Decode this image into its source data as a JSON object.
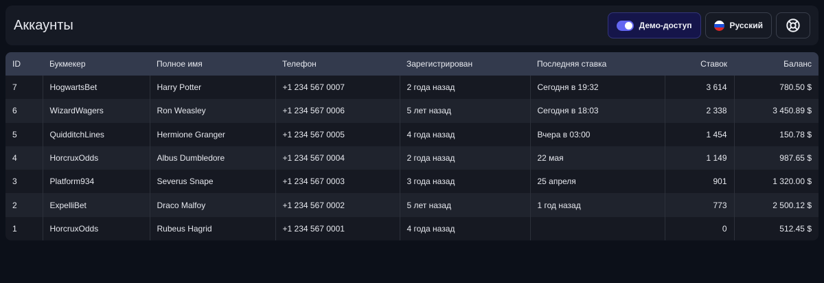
{
  "header": {
    "title": "Аккаунты",
    "demo_label": "Демо-доступ",
    "demo_enabled": true,
    "language_label": "Русский",
    "help_icon": "lifebuoy-icon"
  },
  "table": {
    "columns": [
      "ID",
      "Букмекер",
      "Полное имя",
      "Телефон",
      "Зарегистрирован",
      "Последняя ставка",
      "Ставок",
      "Баланс"
    ],
    "rows": [
      [
        "7",
        "HogwartsBet",
        "Harry Potter",
        "+1 234 567 0007",
        "2 года назад",
        "Сегодня в 19:32",
        "3 614",
        "780.50 $"
      ],
      [
        "6",
        "WizardWagers",
        "Ron Weasley",
        "+1 234 567 0006",
        "5 лет назад",
        "Сегодня в 18:03",
        "2 338",
        "3 450.89 $"
      ],
      [
        "5",
        "QuidditchLines",
        "Hermione Granger",
        "+1 234 567 0005",
        "4 года назад",
        "Вчера в 03:00",
        "1 454",
        "150.78 $"
      ],
      [
        "4",
        "HorcruxOdds",
        "Albus Dumbledore",
        "+1 234 567 0004",
        "2 года назад",
        "22 мая",
        "1 149",
        "987.65 $"
      ],
      [
        "3",
        "Platform934",
        "Severus Snape",
        "+1 234 567 0003",
        "3 года назад",
        "25 апреля",
        "901",
        "1 320.00 $"
      ],
      [
        "2",
        "ExpelliBet",
        "Draco Malfoy",
        "+1 234 567 0002",
        "5 лет назад",
        "1 год назад",
        "773",
        "2 500.12 $"
      ],
      [
        "1",
        "HorcruxOdds",
        "Rubeus Hagrid",
        "+1 234 567 0001",
        "4 года назад",
        "",
        "0",
        "512.45 $"
      ]
    ]
  }
}
